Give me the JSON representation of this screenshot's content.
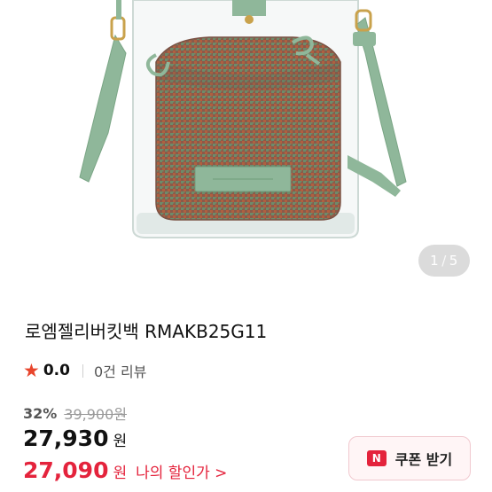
{
  "gallery": {
    "current": "1",
    "separator": "/",
    "total": "5"
  },
  "product": {
    "title": "로엠젤리버킷백 RMAKB25G11",
    "rating": "0.0",
    "reviews": "0건 리뷰",
    "discount_percent": "32%",
    "original_price": "39,900원",
    "price": "27,930",
    "price_unit": "원",
    "my_price": "27,090",
    "my_price_unit": "원",
    "my_price_link": "나의 할인가 >"
  },
  "coupon": {
    "badge": "N",
    "label": "쿠폰 받기"
  },
  "colors": {
    "accent_red": "#e4233c",
    "star": "#e8452c",
    "strap_green": "#8fb79a"
  },
  "icons": [
    "star-icon",
    "coupon-badge-icon"
  ]
}
